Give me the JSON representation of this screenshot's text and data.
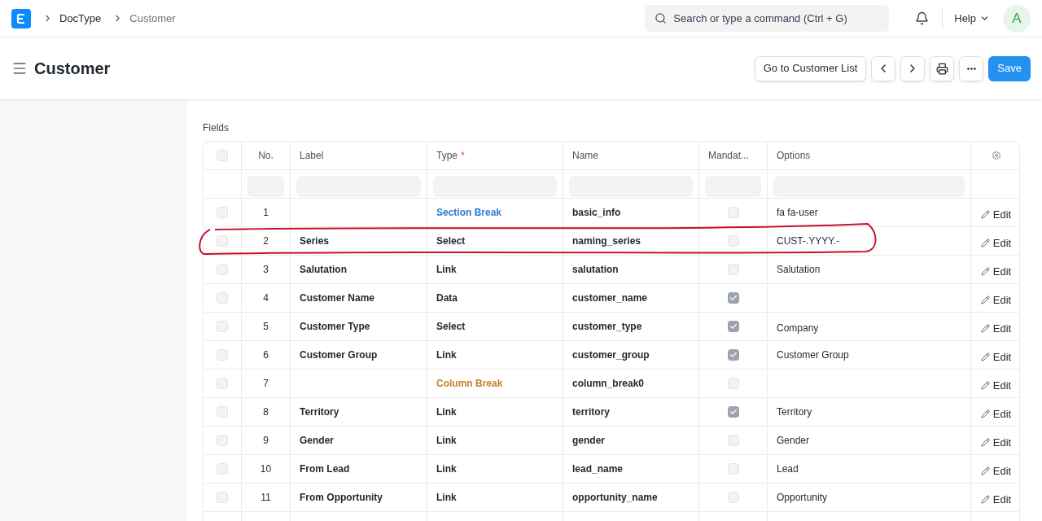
{
  "navbar": {
    "breadcrumbs": [
      "DocType",
      "Customer"
    ],
    "search": {
      "placeholder": "Search or type a command (Ctrl + G)"
    },
    "help": "Help",
    "avatar": "A"
  },
  "page_header": {
    "title": "Customer",
    "buttons": {
      "list": "Go to Customer List",
      "save": "Save"
    }
  },
  "fields_section": {
    "label": "Fields",
    "select_all": false,
    "columns": [
      "No.",
      "Label",
      "Type",
      "Name",
      "Mandat...",
      "Options"
    ],
    "required_mark": "*",
    "rows": [
      {
        "selected": false,
        "no": "1",
        "label": "",
        "type": "Section Break",
        "kind": "section",
        "name": "basic_info",
        "mandatory": false,
        "options": "fa fa-user",
        "edit": "Edit",
        "annotated": false
      },
      {
        "selected": false,
        "no": "2",
        "label": "Series",
        "type": "Select",
        "kind": "field",
        "name": "naming_series",
        "mandatory": false,
        "options": "CUST-.YYYY.-",
        "edit": "Edit",
        "annotated": true
      },
      {
        "selected": false,
        "no": "3",
        "label": "Salutation",
        "type": "Link",
        "kind": "field",
        "name": "salutation",
        "mandatory": false,
        "options": "Salutation",
        "edit": "Edit",
        "annotated": false
      },
      {
        "selected": false,
        "no": "4",
        "label": "Customer Name",
        "type": "Data",
        "kind": "field",
        "name": "customer_name",
        "mandatory": true,
        "options": "",
        "edit": "Edit",
        "annotated": false
      },
      {
        "selected": false,
        "no": "5",
        "label": "Customer Type",
        "type": "Select",
        "kind": "field",
        "name": "customer_type",
        "mandatory": true,
        "options": "Company",
        "edit": "Edit",
        "annotated": false
      },
      {
        "selected": false,
        "no": "6",
        "label": "Customer Group",
        "type": "Link",
        "kind": "field",
        "name": "customer_group",
        "mandatory": true,
        "options": "Customer Group",
        "edit": "Edit",
        "annotated": false
      },
      {
        "selected": false,
        "no": "7",
        "label": "",
        "type": "Column Break",
        "kind": "column",
        "name": "column_break0",
        "mandatory": false,
        "options": "",
        "edit": "Edit",
        "annotated": false
      },
      {
        "selected": false,
        "no": "8",
        "label": "Territory",
        "type": "Link",
        "kind": "field",
        "name": "territory",
        "mandatory": true,
        "options": "Territory",
        "edit": "Edit",
        "annotated": false
      },
      {
        "selected": false,
        "no": "9",
        "label": "Gender",
        "type": "Link",
        "kind": "field",
        "name": "gender",
        "mandatory": false,
        "options": "Gender",
        "edit": "Edit",
        "annotated": false
      },
      {
        "selected": false,
        "no": "10",
        "label": "From Lead",
        "type": "Link",
        "kind": "field",
        "name": "lead_name",
        "mandatory": false,
        "options": "Lead",
        "edit": "Edit",
        "annotated": false
      },
      {
        "selected": false,
        "no": "11",
        "label": "From Opportunity",
        "type": "Link",
        "kind": "field",
        "name": "opportunity_name",
        "mandatory": false,
        "options": "Opportunity",
        "edit": "Edit",
        "annotated": false
      }
    ]
  }
}
